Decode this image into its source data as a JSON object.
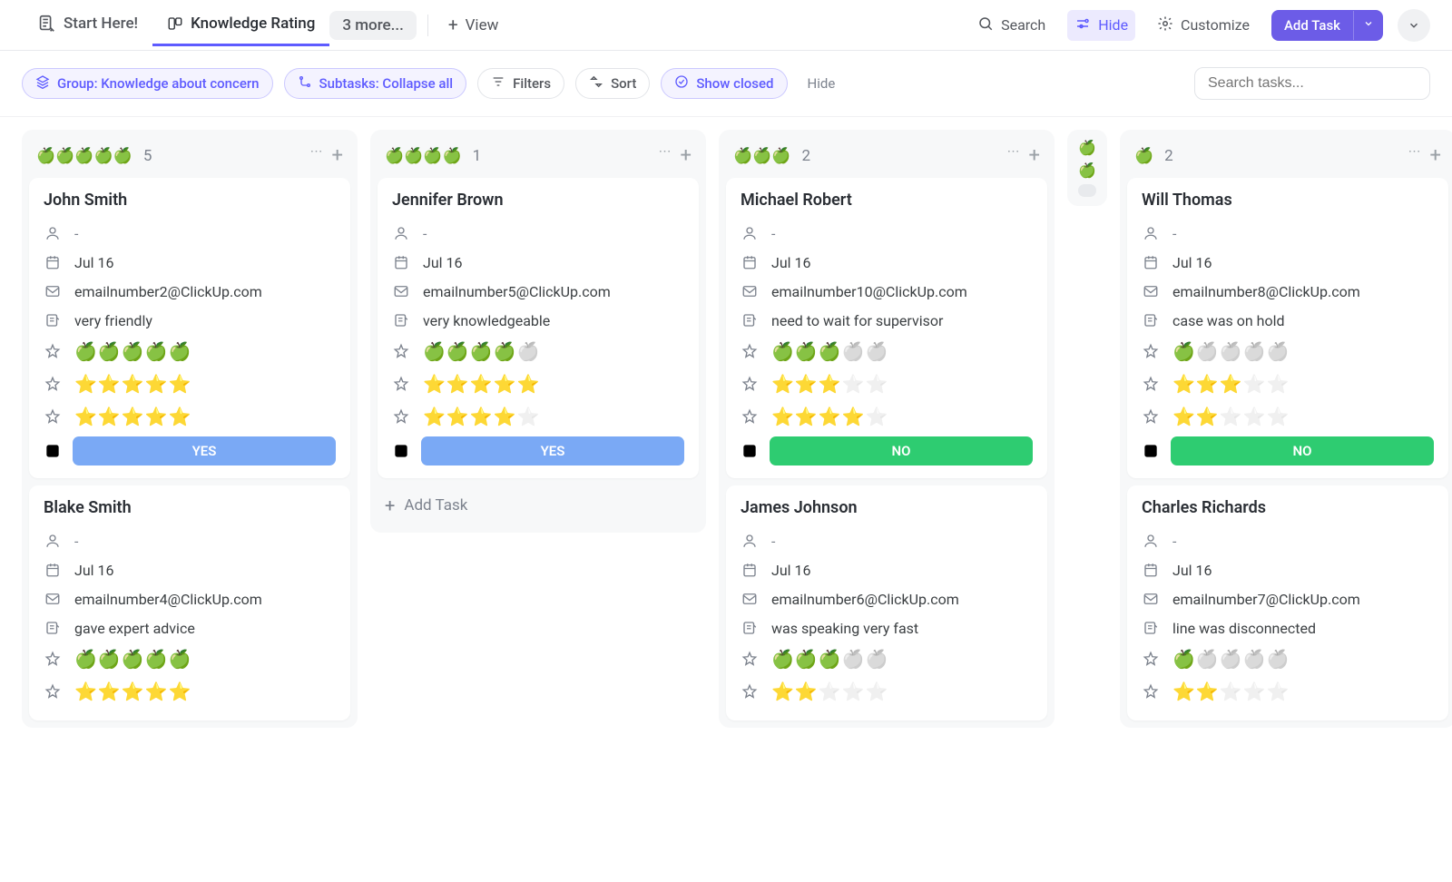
{
  "topbar": {
    "start_here": "Start Here!",
    "active_tab": "Knowledge Rating",
    "more": "3 more...",
    "view": "View",
    "search": "Search",
    "hide": "Hide",
    "customize": "Customize",
    "add_task": "Add Task"
  },
  "filterbar": {
    "group": "Group: Knowledge about concern",
    "subtasks": "Subtasks: Collapse all",
    "filters": "Filters",
    "sort": "Sort",
    "show_closed": "Show closed",
    "hide": "Hide",
    "search_placeholder": "Search tasks..."
  },
  "columns": [
    {
      "apples": 5,
      "count": "5",
      "tasks": [
        {
          "name": "John Smith",
          "assignee": "-",
          "date": "Jul 16",
          "email": "emailnumber2@ClickUp.com",
          "note": "very friendly",
          "apple_rating": "🍏🍏🍏🍏🍏",
          "stars1": "⭐⭐⭐⭐⭐",
          "stars2": "⭐⭐⭐⭐⭐",
          "resolved": "YES",
          "resolved_class": "yes"
        },
        {
          "name": "Blake Smith",
          "assignee": "-",
          "date": "Jul 16",
          "email": "emailnumber4@ClickUp.com",
          "note": "gave expert advice",
          "apple_rating": "🍏🍏🍏🍏🍏",
          "stars1": "⭐⭐⭐⭐⭐",
          "stars2": "",
          "resolved": "",
          "resolved_class": ""
        }
      ],
      "show_add": false
    },
    {
      "apples": 4,
      "count": "1",
      "tasks": [
        {
          "name": "Jennifer Brown",
          "assignee": "-",
          "date": "Jul 16",
          "email": "emailnumber5@ClickUp.com",
          "note": "very knowledgeable",
          "apple_rating": "🍏🍏🍏🍏⬜",
          "stars1": "⭐⭐⭐⭐⭐",
          "stars2": "⭐⭐⭐⭐☆",
          "resolved": "YES",
          "resolved_class": "yes"
        }
      ],
      "show_add": true,
      "add_label": "Add Task"
    },
    {
      "apples": 3,
      "count": "2",
      "tasks": [
        {
          "name": "Michael Robert",
          "assignee": "-",
          "date": "Jul 16",
          "email": "emailnumber10@ClickUp.com",
          "note": "need to wait for supervisor",
          "apple_rating": "🍏🍏🍏⬜⬜",
          "stars1": "⭐⭐⭐☆☆",
          "stars2": "⭐⭐⭐⭐☆",
          "resolved": "NO",
          "resolved_class": "no"
        },
        {
          "name": "James Johnson",
          "assignee": "-",
          "date": "Jul 16",
          "email": "emailnumber6@ClickUp.com",
          "note": "was speaking very fast",
          "apple_rating": "🍏🍏🍏⬜⬜",
          "stars1": "⭐⭐☆☆☆",
          "stars2": "",
          "resolved": "",
          "resolved_class": ""
        }
      ],
      "show_add": false
    }
  ],
  "mini_column": {
    "apples": 2
  },
  "column4": {
    "apples": 1,
    "count": "2",
    "tasks": [
      {
        "name": "Will Thomas",
        "assignee": "-",
        "date": "Jul 16",
        "email": "emailnumber8@ClickUp.com",
        "note": "case was on hold",
        "apple_rating": "🍏⬜⬜⬜⬜",
        "stars1": "⭐⭐⭐☆☆",
        "stars2": "⭐⭐☆☆☆",
        "resolved": "NO",
        "resolved_class": "no"
      },
      {
        "name": "Charles Richards",
        "assignee": "-",
        "date": "Jul 16",
        "email": "emailnumber7@ClickUp.com",
        "note": "line was disconnected",
        "apple_rating": "🍏⬜⬜⬜⬜",
        "stars1": "⭐⭐☆☆☆",
        "stars2": "",
        "resolved": "",
        "resolved_class": ""
      }
    ]
  }
}
